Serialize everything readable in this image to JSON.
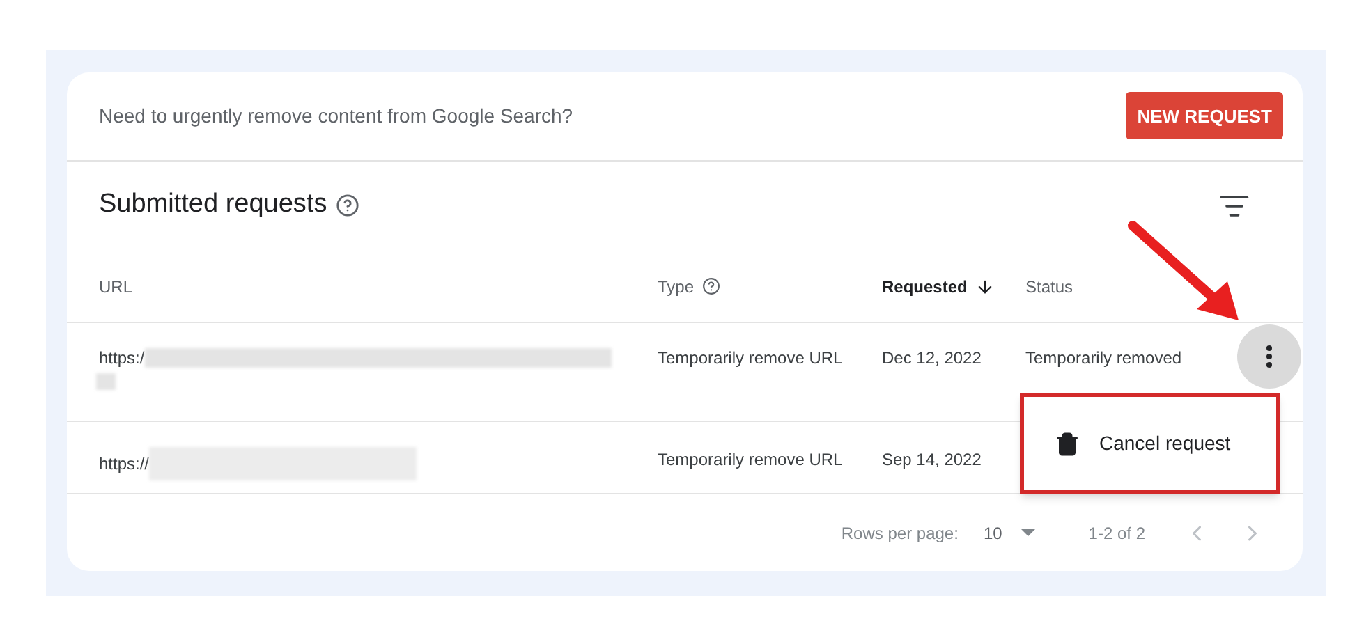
{
  "banner": {
    "text": "Need to urgently remove content from Google Search?",
    "button": "NEW REQUEST"
  },
  "section": {
    "title": "Submitted requests"
  },
  "table": {
    "columns": [
      {
        "label": "URL",
        "help": false,
        "sorted": false
      },
      {
        "label": "Type",
        "help": true,
        "sorted": false
      },
      {
        "label": "Requested",
        "help": false,
        "sorted": true
      },
      {
        "label": "Status",
        "help": false,
        "sorted": false
      }
    ],
    "rows": [
      {
        "url": "https:/",
        "type": "Temporarily remove URL",
        "requested": "Dec 12, 2022",
        "status": "Temporarily removed"
      },
      {
        "url": "https://",
        "type": "Temporarily remove URL",
        "requested": "Sep 14, 2022"
      }
    ]
  },
  "menu": {
    "open": true,
    "items": [
      "Cancel request"
    ]
  },
  "pagination": {
    "rows_label": "Rows per page:",
    "rows_value": "10",
    "range": "1-2 of 2"
  }
}
